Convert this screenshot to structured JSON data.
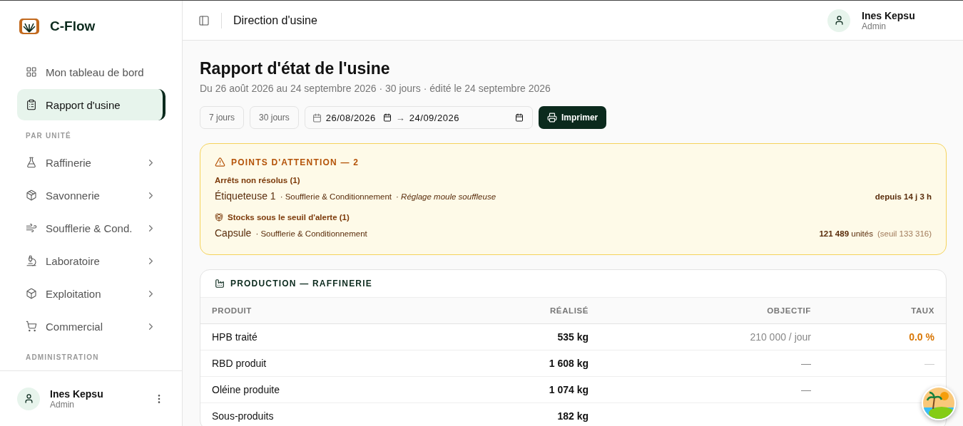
{
  "brand": {
    "name": "C-Flow"
  },
  "sidebar": {
    "items": [
      {
        "label": "Mon tableau de bord",
        "selected": false
      },
      {
        "label": "Rapport d'usine",
        "selected": true
      }
    ],
    "sections": [
      {
        "title": "PAR UNITÉ",
        "items": [
          {
            "label": "Raffinerie"
          },
          {
            "label": "Savonnerie"
          },
          {
            "label": "Soufflerie & Cond."
          },
          {
            "label": "Laboratoire"
          },
          {
            "label": "Exploitation"
          },
          {
            "label": "Commercial"
          }
        ]
      },
      {
        "title": "ADMINISTRATION"
      }
    ],
    "user": {
      "name": "Ines Kepsu",
      "role": "Admin"
    }
  },
  "header": {
    "title": "Direction d'usine",
    "user": {
      "name": "Ines Kepsu",
      "role": "Admin"
    }
  },
  "page": {
    "title": "Rapport d'état de l'usine",
    "subtitle": "Du 26 août 2026 au 24 septembre 2026 · 30 jours · édité le 24 septembre 2026",
    "presets": [
      {
        "label": "7 jours"
      },
      {
        "label": "30 jours"
      }
    ],
    "date_from": "26/08/2026",
    "arrow": "→",
    "date_to": "24/09/2026",
    "print_button": "Imprimer"
  },
  "attention": {
    "title": "POINTS D'ATTENTION — 2",
    "groups": [
      {
        "title": "Arrêts non résolus (1)",
        "kind": "stop",
        "items": [
          {
            "name": "Étiqueteuse 1",
            "unit": "· Soufflerie & Conditionnement",
            "note": "· Réglage moule souffleuse",
            "value": "depuis 14 j 3 h"
          }
        ]
      },
      {
        "title": "Stocks sous le seuil d'alerte (1)",
        "kind": "stock",
        "items": [
          {
            "name": "Capsule",
            "unit": "· Soufflerie & Conditionnement",
            "value": "121 489",
            "value_unit": "unités",
            "threshold": "(seuil 133 316)"
          }
        ]
      }
    ]
  },
  "production": {
    "title": "PRODUCTION — RAFFINERIE",
    "columns": [
      "PRODUIT",
      "RÉALISÉ",
      "OBJECTIF",
      "TAUX"
    ],
    "rows": [
      [
        "HPB traité",
        "535 kg",
        "210 000 / jour",
        "0.0 %"
      ],
      [
        "RBD produit",
        "1 608 kg",
        "—",
        "—"
      ],
      [
        "Oléine produite",
        "1 074 kg",
        "—",
        ""
      ],
      [
        "Sous-produits",
        "182 kg",
        "",
        ""
      ]
    ]
  }
}
